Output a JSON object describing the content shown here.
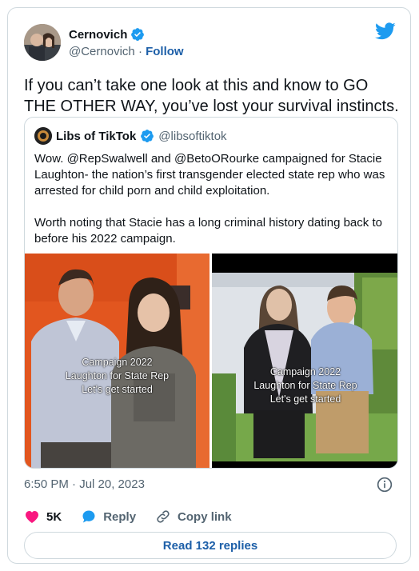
{
  "tweet": {
    "author_name": "Cernovich",
    "author_handle": "@Cernovich",
    "separator": "·",
    "follow_label": "Follow",
    "text": "If you can’t take one look at this and know to GO THE OTHER WAY, you’ve lost your survival instincts.",
    "timestamp": "6:50 PM · Jul 20, 2023"
  },
  "quoted": {
    "author_name": "Libs of TikTok",
    "author_handle": "@libsoftiktok",
    "paragraph1": "Wow. @RepSwalwell and @BetoORourke campaigned for Stacie Laughton- the nation’s first transgender elected state rep who was arrested for child porn and child exploitation.",
    "paragraph2": "Worth noting that Stacie has a long criminal history dating back to before his 2022 campaign.",
    "media_overlay": {
      "line1": "Campaign 2022",
      "line2": "Laughton for State Rep",
      "line3": "Let's get started"
    }
  },
  "actions": {
    "likes": "5K",
    "reply_label": "Reply",
    "copy_link_label": "Copy link"
  },
  "read_replies_label": "Read 132 replies",
  "colors": {
    "verified_blue": "#1d9bf0",
    "link_blue": "#1d5fa8",
    "like_pink": "#f91880",
    "muted_gray": "#536471"
  },
  "icons": [
    "verified-badge-icon",
    "twitter-bird-icon",
    "info-icon",
    "heart-icon",
    "reply-bubble-icon",
    "link-icon"
  ]
}
